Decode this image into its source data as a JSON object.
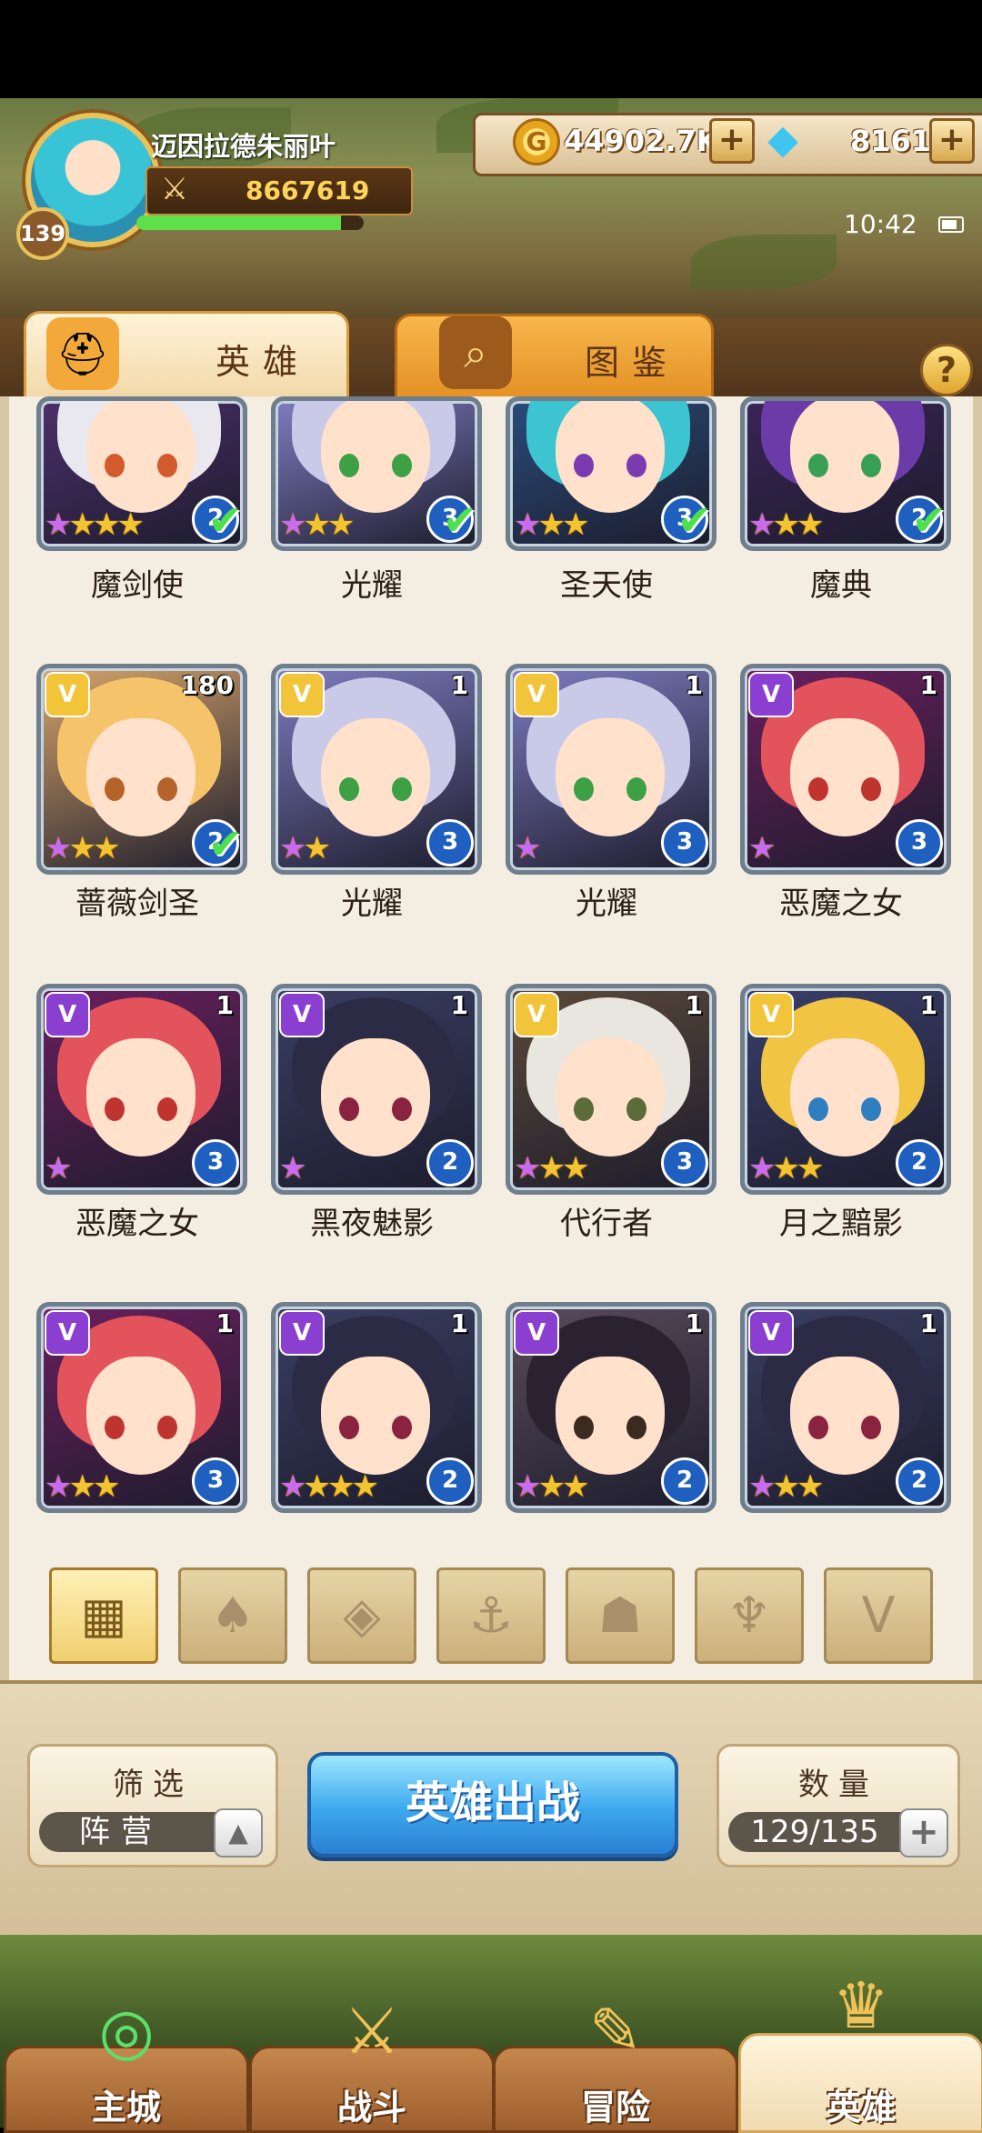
{
  "player": {
    "name": "迈因拉德朱丽叶",
    "level": "139",
    "power": "8667619",
    "exp_fraction": 0.9
  },
  "currency": {
    "gold": "44902.7K",
    "gold_symbol": "G",
    "gems": "8161",
    "plus": "+"
  },
  "status": {
    "time": "10:42"
  },
  "tabs": [
    {
      "label": "英雄",
      "icon": "helmet-icon"
    },
    {
      "label": "图鉴",
      "icon": "magnifier-icon"
    }
  ],
  "help": "?",
  "heroes": [
    {
      "name": "魔剑使",
      "count": "",
      "stars": 4,
      "level": "2",
      "deployed": true,
      "faction": "",
      "hair": "#e8e8ee",
      "bg": "#4c2f6b",
      "eye": "#d25a2c"
    },
    {
      "name": "光耀",
      "count": "",
      "stars": 3,
      "level": "3",
      "deployed": true,
      "faction": "",
      "hair": "#c9c9e8",
      "bg": "#7e7cc0",
      "eye": "#3da045"
    },
    {
      "name": "圣天使",
      "count": "",
      "stars": 3,
      "level": "3",
      "deployed": true,
      "faction": "",
      "hair": "#3cc4d0",
      "bg": "#2b4b7a",
      "eye": "#7b3bb0"
    },
    {
      "name": "魔典",
      "count": "",
      "stars": 3,
      "level": "2",
      "deployed": true,
      "faction": "",
      "hair": "#6b3ca8",
      "bg": "#3a2456",
      "eye": "#38a055"
    },
    {
      "name": "蔷薇剑圣",
      "count": "180",
      "stars": 3,
      "level": "2",
      "deployed": true,
      "faction": "light",
      "hair": "#f5c36a",
      "bg": "#d6a56b",
      "eye": "#b4632b"
    },
    {
      "name": "光耀",
      "count": "1",
      "stars": 2,
      "level": "3",
      "deployed": false,
      "faction": "light",
      "hair": "#c9c9e8",
      "bg": "#7e7cc0",
      "eye": "#3da045"
    },
    {
      "name": "光耀",
      "count": "1",
      "stars": 1,
      "level": "3",
      "deployed": false,
      "faction": "light",
      "hair": "#c9c9e8",
      "bg": "#7e7cc0",
      "eye": "#3da045"
    },
    {
      "name": "恶魔之女",
      "count": "1",
      "stars": 1,
      "level": "3",
      "deployed": false,
      "faction": "dark",
      "hair": "#e2535c",
      "bg": "#6a1f5e",
      "eye": "#c0342f"
    },
    {
      "name": "恶魔之女",
      "count": "1",
      "stars": 1,
      "level": "3",
      "deployed": false,
      "faction": "dark",
      "hair": "#e2535c",
      "bg": "#6a1f5e",
      "eye": "#c0342f"
    },
    {
      "name": "黑夜魅影",
      "count": "1",
      "stars": 1,
      "level": "2",
      "deployed": false,
      "faction": "dark",
      "hair": "#2b2b45",
      "bg": "#3a3f63",
      "eye": "#8a2340"
    },
    {
      "name": "代行者",
      "count": "1",
      "stars": 3,
      "level": "3",
      "deployed": false,
      "faction": "light",
      "hair": "#e9e6e0",
      "bg": "#5c4a3a",
      "eye": "#5b6b3a"
    },
    {
      "name": "月之黯影",
      "count": "1",
      "stars": 3,
      "level": "2",
      "deployed": false,
      "faction": "light",
      "hair": "#f2c443",
      "bg": "#3a3f6b",
      "eye": "#2f7fc0"
    },
    {
      "name": "",
      "count": "1",
      "stars": 3,
      "level": "3",
      "deployed": false,
      "faction": "dark",
      "hair": "#e2535c",
      "bg": "#6a1f5e",
      "eye": "#c0342f"
    },
    {
      "name": "",
      "count": "1",
      "stars": 4,
      "level": "2",
      "deployed": false,
      "faction": "dark",
      "hair": "#2b2b45",
      "bg": "#3a3f63",
      "eye": "#8a2340"
    },
    {
      "name": "",
      "count": "1",
      "stars": 3,
      "level": "2",
      "deployed": false,
      "faction": "dark",
      "hair": "#2a2230",
      "bg": "#5a4c5c",
      "eye": "#3a2a20"
    },
    {
      "name": "",
      "count": "1",
      "stars": 3,
      "level": "2",
      "deployed": false,
      "faction": "dark",
      "hair": "#2b2b45",
      "bg": "#3a3f63",
      "eye": "#8a2340"
    }
  ],
  "faction_filters": [
    {
      "icon": "grid-icon",
      "glyph": "▦"
    },
    {
      "icon": "leaf-icon",
      "glyph": "♠"
    },
    {
      "icon": "diamond-icon",
      "glyph": "◈"
    },
    {
      "icon": "anchor-icon",
      "glyph": "⚓"
    },
    {
      "icon": "beast-icon",
      "glyph": "☗"
    },
    {
      "icon": "demon-icon",
      "glyph": "♆"
    },
    {
      "icon": "wing-icon",
      "glyph": "V"
    }
  ],
  "controls": {
    "filter_title": "筛选",
    "filter_value": "阵营",
    "deploy_label": "英雄出战",
    "count_title": "数量",
    "count_value": "129/135"
  },
  "nav": [
    {
      "label": "主城",
      "icon": "city-icon",
      "glyph": "◎"
    },
    {
      "label": "战斗",
      "icon": "swords-icon",
      "glyph": "⚔"
    },
    {
      "label": "冒险",
      "icon": "scroll-icon",
      "glyph": "✎"
    },
    {
      "label": "英雄",
      "icon": "helmet-icon",
      "glyph": "♛"
    }
  ],
  "colors": {
    "accent_gold": "#f2c431",
    "deploy_blue": "#3ba8ee",
    "light_faction": "#f2c43a",
    "dark_faction": "#8a3fd0"
  }
}
